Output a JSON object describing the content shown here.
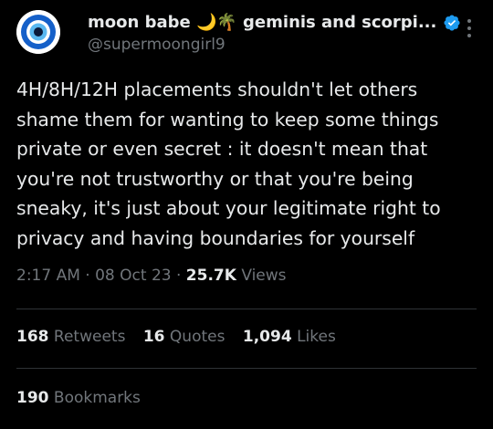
{
  "user": {
    "display_name": "moon babe 🌙🌴 geminis and scorpi...",
    "handle": "@supermoongirl9",
    "verified_icon": "verified-badge-icon",
    "avatar_icon": "evil-eye-icon"
  },
  "tweet": {
    "text": "4H/8H/12H placements shouldn't let others shame them for wanting to keep some things private or even secret : it doesn't mean that you're not trustworthy or that you're being sneaky, it's just about your legitimate right to privacy and having boundaries for yourself",
    "time": "2:17 AM",
    "date": "08 Oct 23",
    "views_count": "25.7K",
    "views_label": "Views",
    "separator": "·"
  },
  "stats": {
    "retweets_count": "168",
    "retweets_label": "Retweets",
    "quotes_count": "16",
    "quotes_label": "Quotes",
    "likes_count": "1,094",
    "likes_label": "Likes",
    "bookmarks_count": "190",
    "bookmarks_label": "Bookmarks"
  },
  "colors": {
    "background": "#000000",
    "text_primary": "#e7e9ea",
    "text_secondary": "#71767b",
    "verified": "#1d9bf0",
    "divider": "#2f3336"
  }
}
